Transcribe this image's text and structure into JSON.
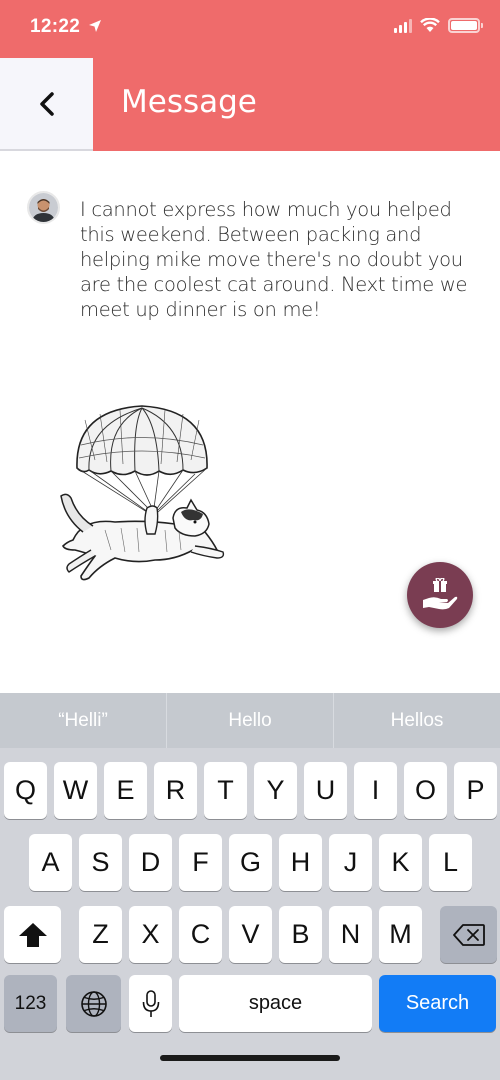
{
  "status_bar": {
    "time": "12:22"
  },
  "header": {
    "title": "Message"
  },
  "message": {
    "text": "I cannot express how much you helped this weekend. Between packing and helping mike move there's no doubt you are the coolest cat around. Next time we meet up dinner is on me!"
  },
  "colors": {
    "header": "#ef6b6b",
    "fab": "#7a3d52",
    "search_key": "#127cf6"
  },
  "keyboard": {
    "suggestions": [
      "“Helli”",
      "Hello",
      "Hellos"
    ],
    "row1": [
      "Q",
      "W",
      "E",
      "R",
      "T",
      "Y",
      "U",
      "I",
      "O",
      "P"
    ],
    "row2": [
      "A",
      "S",
      "D",
      "F",
      "G",
      "H",
      "J",
      "K",
      "L"
    ],
    "row3": [
      "Z",
      "X",
      "C",
      "V",
      "B",
      "N",
      "M"
    ],
    "numbers_label": "123",
    "space_label": "space",
    "action_label": "Search"
  }
}
